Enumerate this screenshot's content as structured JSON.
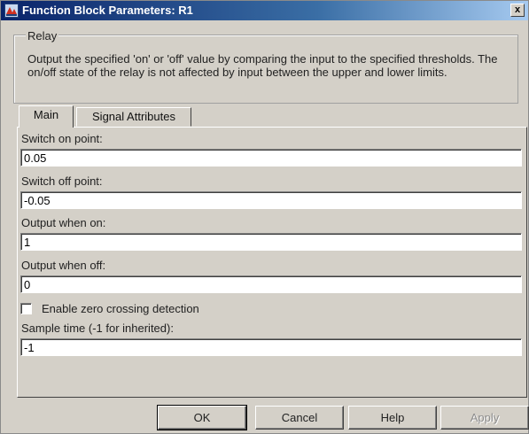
{
  "window": {
    "title": "Function Block Parameters: R1",
    "close_glyph": "x"
  },
  "group": {
    "legend": "Relay",
    "description": "Output the specified 'on' or 'off' value by comparing the input to the specified thresholds.  The on/off state of the relay is not affected by input between the upper and lower limits."
  },
  "tabs": [
    {
      "label": "Main",
      "selected": true
    },
    {
      "label": "Signal Attributes",
      "selected": false
    }
  ],
  "fields": {
    "switch_on": {
      "label": "Switch on point:",
      "value": "0.05"
    },
    "switch_off": {
      "label": "Switch off point:",
      "value": "-0.05"
    },
    "output_on": {
      "label": "Output when on:",
      "value": "1"
    },
    "output_off": {
      "label": "Output when off:",
      "value": "0"
    },
    "zero_crossing": {
      "label": "Enable zero crossing detection",
      "checked": false
    },
    "sample_time": {
      "label": "Sample time (-1 for inherited):",
      "value": "-1"
    }
  },
  "buttons": {
    "ok": "OK",
    "cancel": "Cancel",
    "help": "Help",
    "apply": "Apply"
  },
  "icons": {
    "app": "simulink-block-icon",
    "close": "close-icon"
  }
}
